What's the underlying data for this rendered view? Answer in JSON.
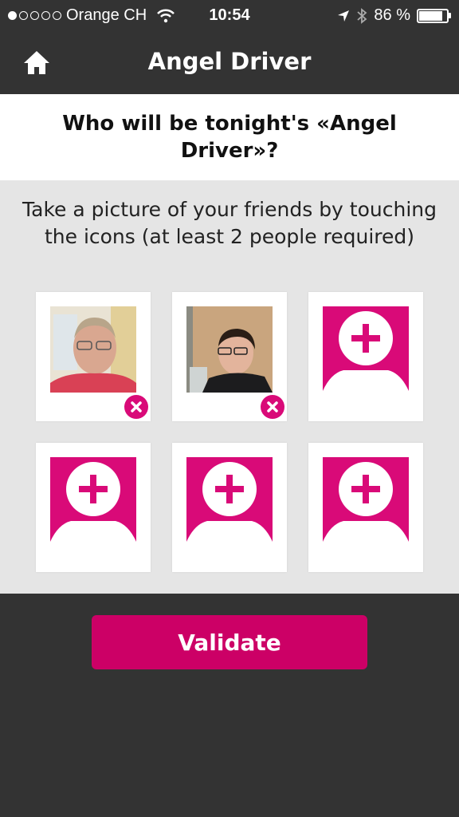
{
  "status_bar": {
    "carrier": "Orange CH",
    "time": "10:54",
    "battery_percent": "86 %",
    "battery_level": 0.86,
    "signal_dots": 1
  },
  "nav": {
    "title": "Angel Driver"
  },
  "question": "Who will be tonight's «Angel Driver»?",
  "instructions": "Take a picture of your friends by touching the icons (at least 2 people required)",
  "tiles": [
    {
      "state": "photo"
    },
    {
      "state": "photo"
    },
    {
      "state": "empty"
    },
    {
      "state": "empty"
    },
    {
      "state": "empty"
    },
    {
      "state": "empty"
    }
  ],
  "validate_label": "Validate",
  "colors": {
    "accent": "#d90a78",
    "button": "#cc0066",
    "background": "#333333"
  }
}
